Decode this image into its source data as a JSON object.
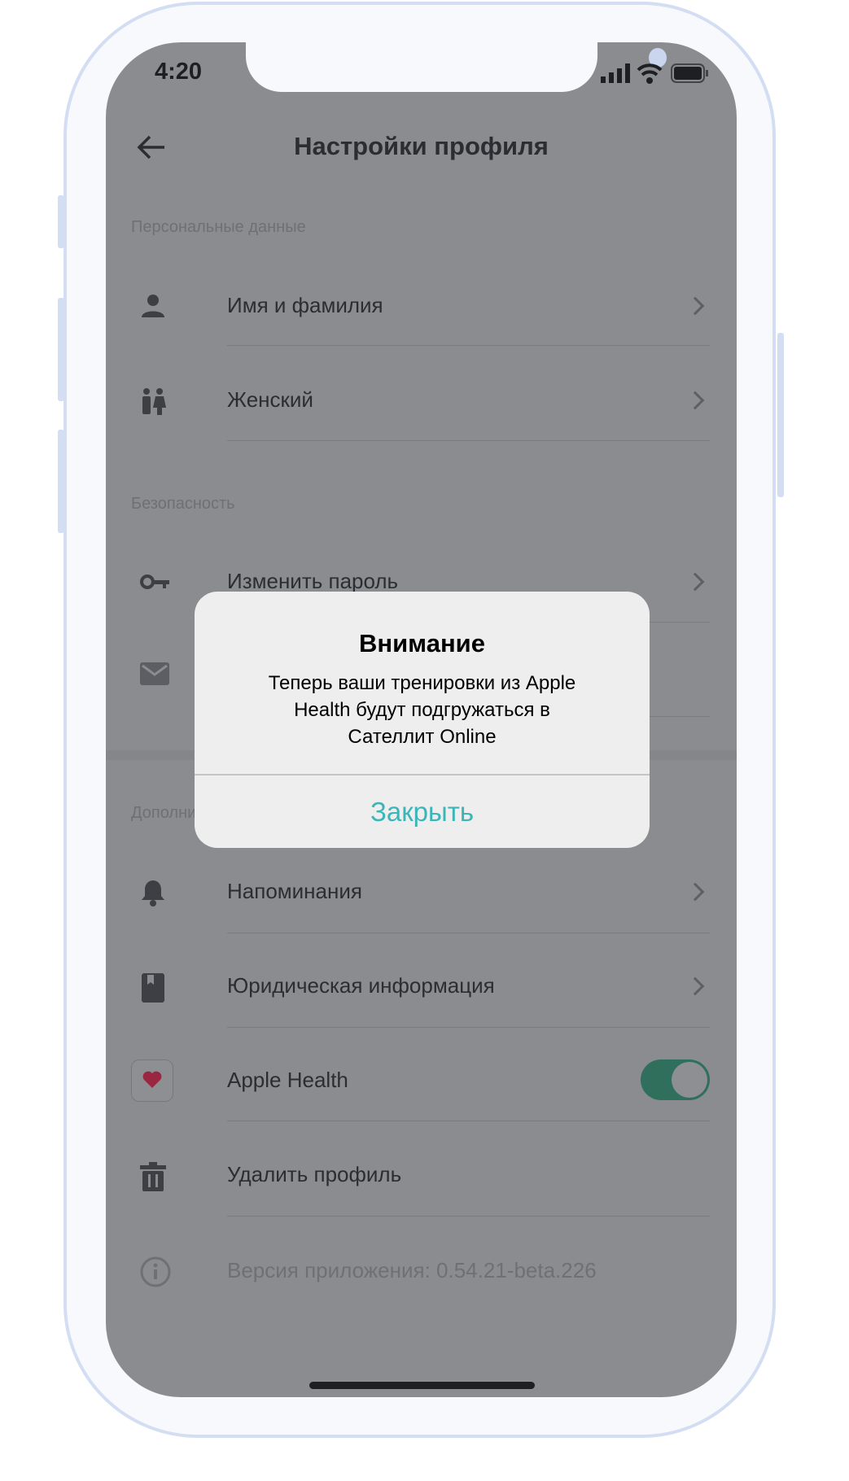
{
  "status_bar": {
    "time": "4:20",
    "icons": [
      "signal-icon",
      "wifi-icon",
      "battery-icon"
    ]
  },
  "header": {
    "title": "Настройки профиля",
    "back_icon": "arrow-left-icon"
  },
  "sections": [
    {
      "title": "Персональные данные",
      "items": [
        {
          "label": "Имя и фамилия",
          "icon": "person-icon"
        },
        {
          "label": "Женский",
          "icon": "gender-icon"
        }
      ]
    },
    {
      "title": "Безопасность",
      "items": [
        {
          "label": "Изменить пароль",
          "icon": "key-icon"
        },
        {
          "label": "",
          "icon": "mail-icon"
        }
      ]
    },
    {
      "title": "Дополнительно",
      "items": [
        {
          "label": "Напоминания",
          "icon": "bell-icon"
        },
        {
          "label": "Юридическая информация",
          "icon": "book-icon"
        },
        {
          "label": "Apple Health",
          "icon": "heart-icon",
          "toggle_on": true
        },
        {
          "label": "Удалить профиль",
          "icon": "trash-icon"
        }
      ]
    }
  ],
  "version": "Версия приложения: 0.54.21-beta.226",
  "dialog": {
    "title": "Внимание",
    "message_lines": [
      "Теперь ваши тренировки из Apple",
      "Health будут подгружаться в",
      "Сателлит Online"
    ],
    "button": "Закрыть"
  },
  "colors": {
    "accent": "#3ab5b8",
    "toggle": "#2f6f5b",
    "overlay": "#8b8c8f"
  }
}
